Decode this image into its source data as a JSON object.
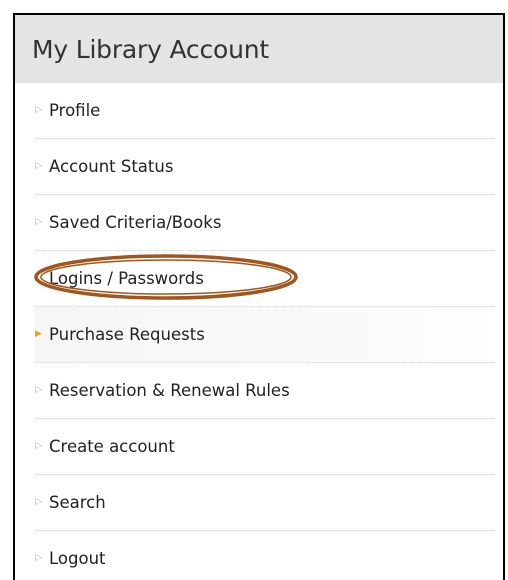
{
  "header": {
    "title": "My Library Account"
  },
  "menu": {
    "items": [
      {
        "label": "Profile",
        "icon": "right-arrow-bullet"
      },
      {
        "label": "Account Status",
        "icon": "right-arrow-bullet"
      },
      {
        "label": "Saved Criteria/Books",
        "icon": "right-arrow-bullet"
      },
      {
        "label": "Logins / Passwords",
        "icon": "right-arrow-bullet",
        "highlighted": true
      },
      {
        "label": "Purchase Requests",
        "icon": "right-arrow-bullet",
        "active": true
      },
      {
        "label": "Reservation & Renewal Rules",
        "icon": "right-arrow-bullet"
      },
      {
        "label": "Create account",
        "icon": "right-arrow-bullet"
      },
      {
        "label": "Search",
        "icon": "right-arrow-bullet"
      },
      {
        "label": "Logout",
        "icon": "right-arrow-bullet"
      }
    ]
  },
  "colors": {
    "header_bg": "#e4e4e4",
    "active_bullet": "#f0a31c",
    "bullet": "#b8b8b8",
    "highlight_ring": "#a0561d",
    "border": "#000000"
  }
}
